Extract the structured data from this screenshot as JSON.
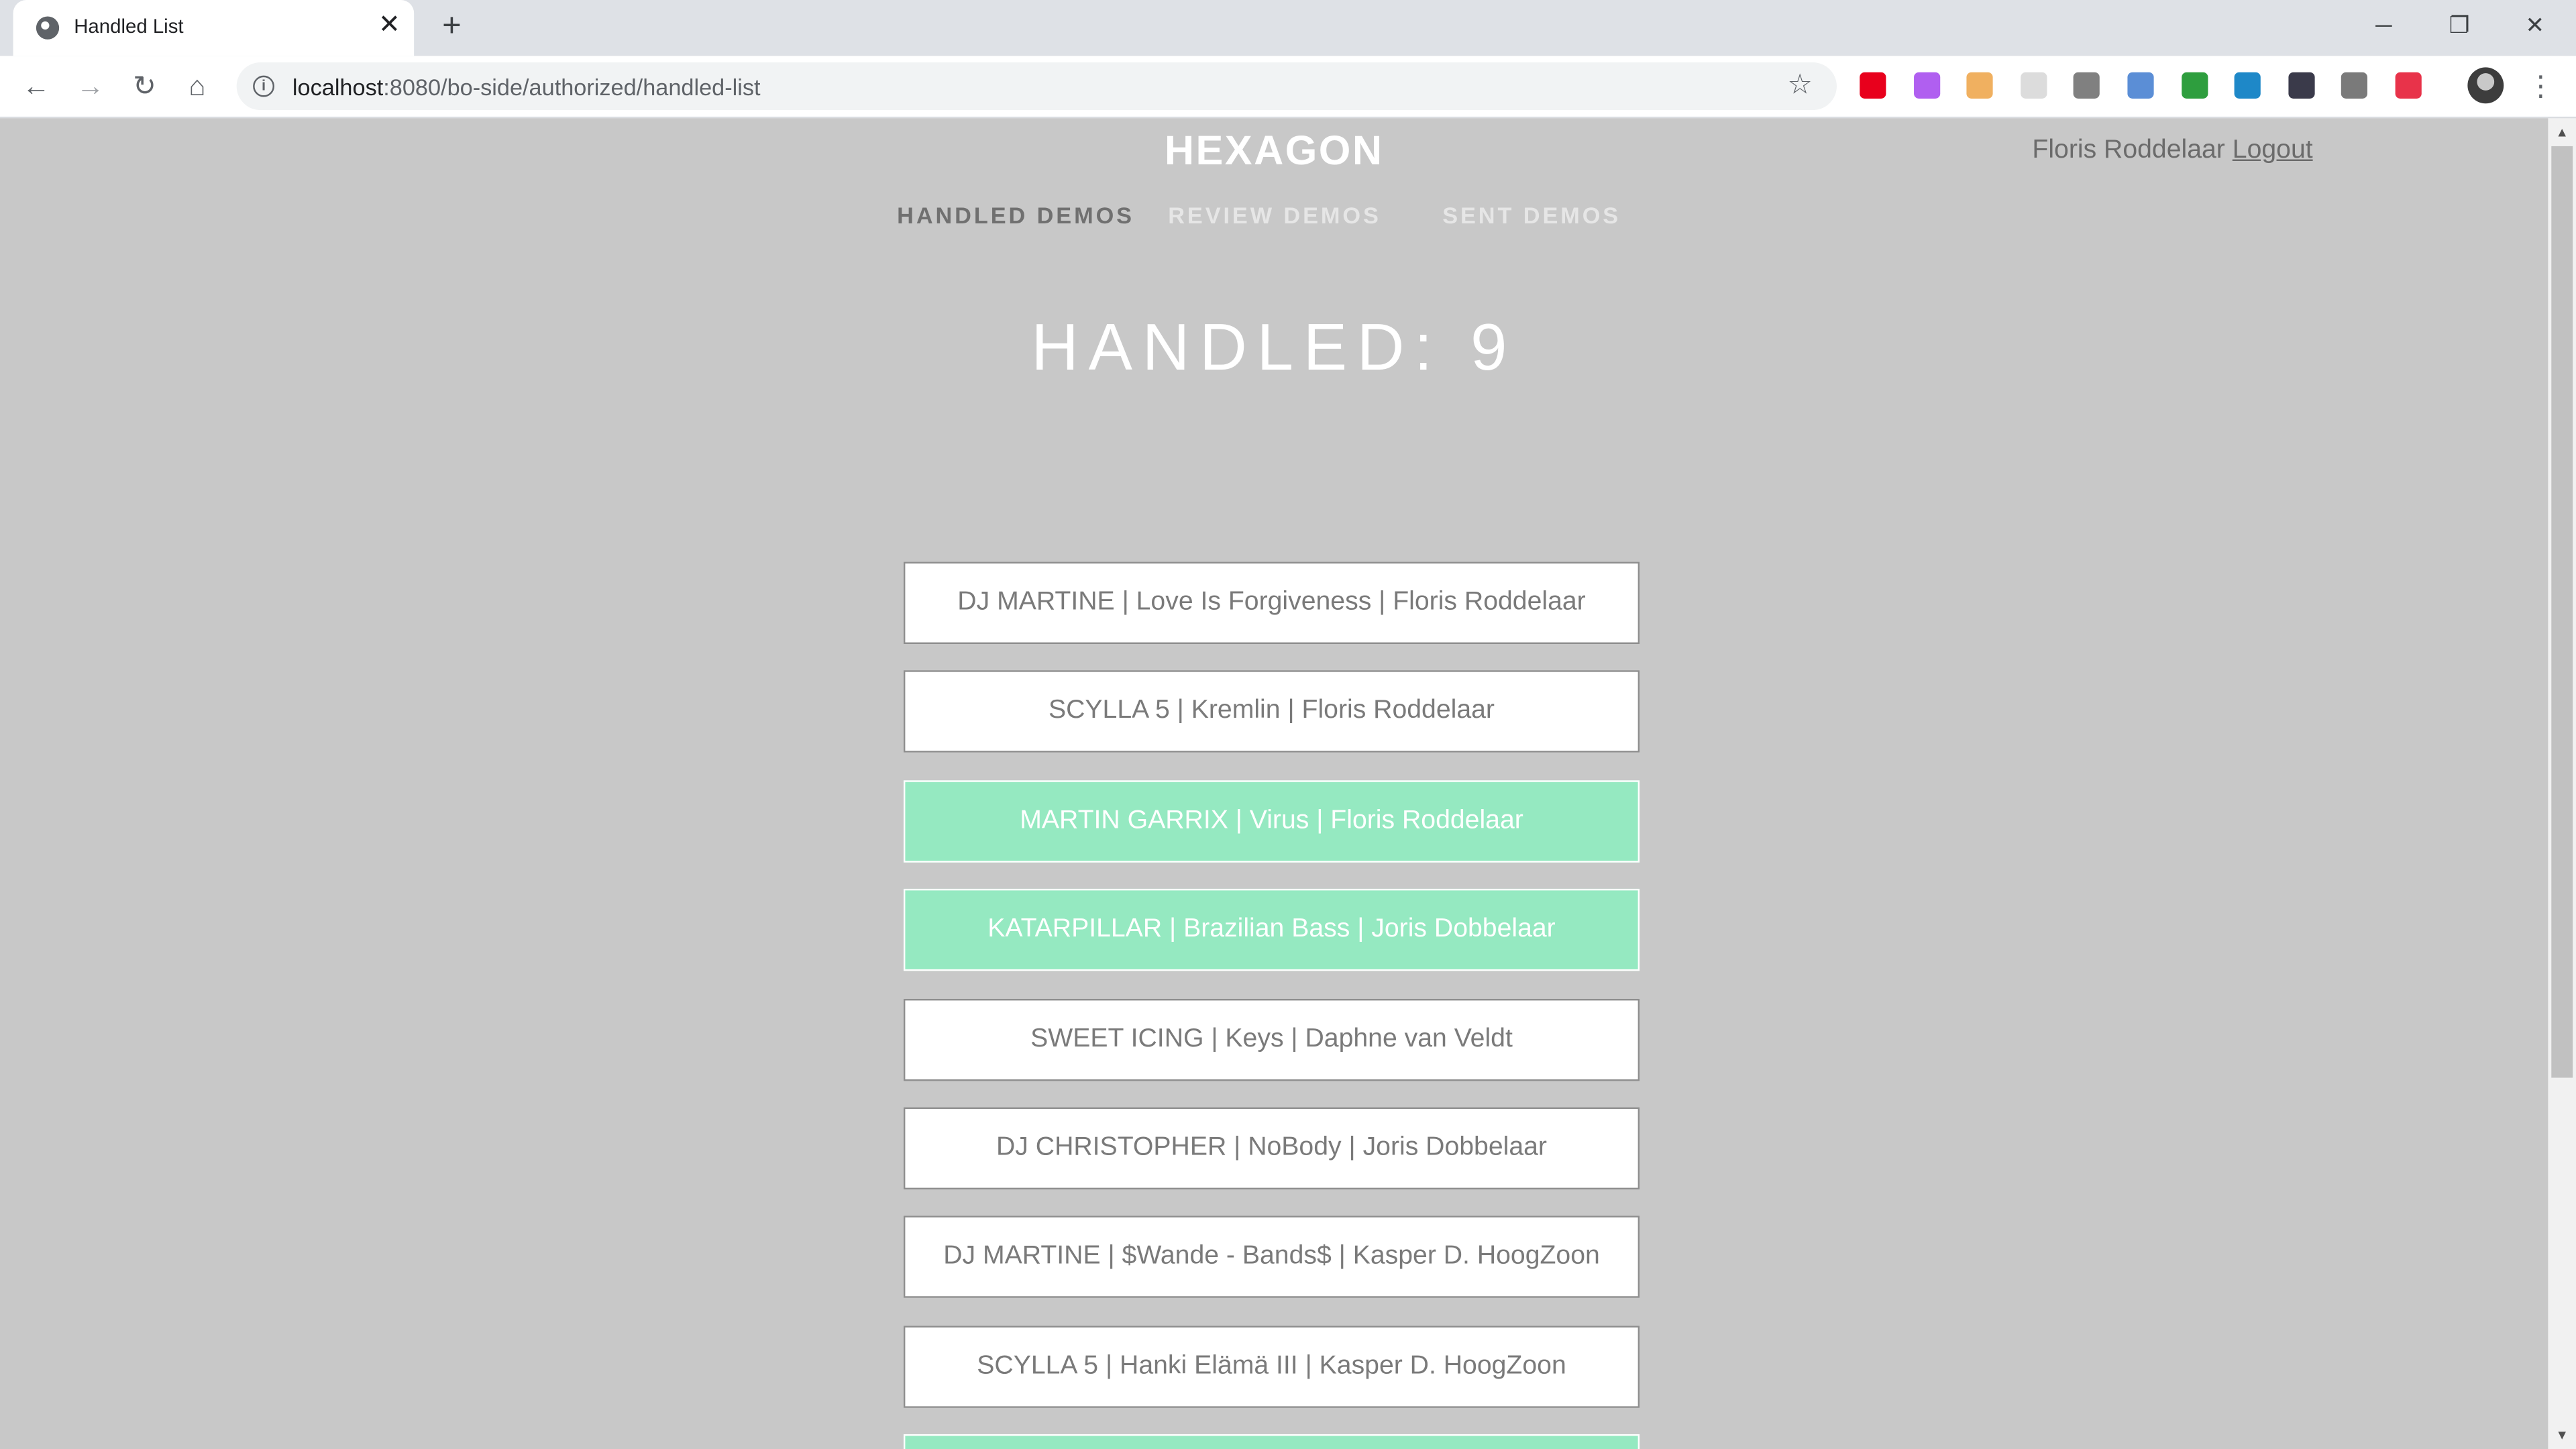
{
  "browser": {
    "tab_title": "Handled List",
    "tab_close": "✕",
    "new_tab": "+",
    "url_host": "localhost",
    "url_path": ":8080/bo-side/authorized/handled-list",
    "window_controls": [
      "─",
      "❐",
      "✕"
    ],
    "extensions": [
      {
        "name": "opera-icon",
        "color": "#e8001c"
      },
      {
        "name": "paint-icon",
        "color": "#b05ff0"
      },
      {
        "name": "calendar-icon",
        "color": "#f0b060"
      },
      {
        "name": "blank-ext-icon",
        "color": "#dcdcdc"
      },
      {
        "name": "gear-ext-icon",
        "color": "#808080"
      },
      {
        "name": "compass-ext-icon",
        "color": "#5b8ed6"
      },
      {
        "name": "android-ext-icon",
        "color": "#2e9e3e"
      },
      {
        "name": "monitor-ext-icon",
        "color": "#1e88c8"
      },
      {
        "name": "x-ext-icon",
        "color": "#3a3a4a"
      },
      {
        "name": "s-ext-icon",
        "color": "#7a7a7a"
      },
      {
        "name": "play-ext-icon",
        "color": "#e8334a"
      }
    ]
  },
  "app": {
    "logo": "HEXAGON",
    "user_name": "Floris Roddelaar",
    "logout": "Logout",
    "nav": {
      "handled": "HANDLED DEMOS",
      "review": "REVIEW DEMOS",
      "sent": "SENT DEMOS"
    },
    "heading": "HANDLED: 9",
    "items": [
      {
        "text": "DJ MARTINE | Love Is Forgiveness | Floris Roddelaar",
        "highlighted": false
      },
      {
        "text": "SCYLLA 5 | Kremlin | Floris Roddelaar",
        "highlighted": false
      },
      {
        "text": "MARTIN GARRIX | Virus | Floris Roddelaar",
        "highlighted": true
      },
      {
        "text": "KATARPILLAR | Brazilian Bass | Joris Dobbelaar",
        "highlighted": true
      },
      {
        "text": "SWEET ICING | Keys | Daphne van Veldt",
        "highlighted": false
      },
      {
        "text": "DJ CHRISTOPHER | NoBody | Joris Dobbelaar",
        "highlighted": false
      },
      {
        "text": "DJ MARTINE | $Wande - Bands$ | Kasper D. HoogZoon",
        "highlighted": false
      },
      {
        "text": "SCYLLA 5 | Hanki Elämä III | Kasper D. HoogZoon",
        "highlighted": false
      },
      {
        "text": "",
        "highlighted": true
      }
    ],
    "colors": {
      "background": "#c8c8c8",
      "highlight": "#95e9c1"
    }
  }
}
